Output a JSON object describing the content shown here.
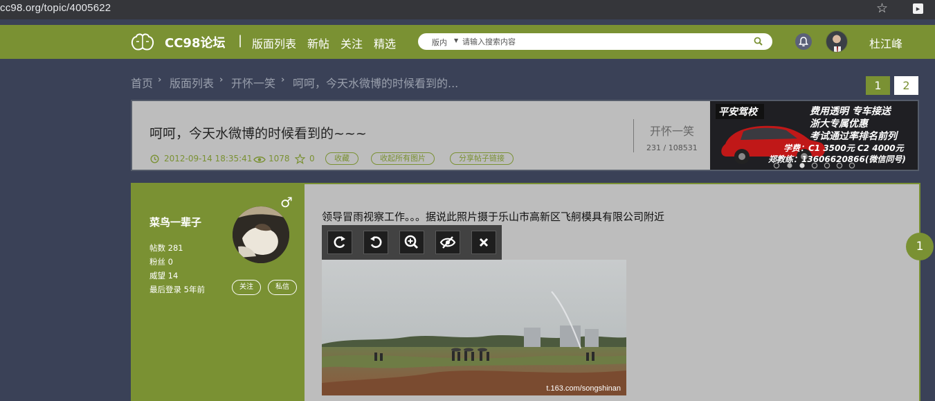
{
  "browser": {
    "url": "cc98.org/topic/4005622"
  },
  "nav": {
    "brand": "CC98论坛",
    "separator": "|",
    "links": [
      "版面列表",
      "新帖",
      "关注",
      "精选"
    ],
    "search": {
      "scope": "版内",
      "placeholder": "请输入搜索内容"
    },
    "username": "杜江峰"
  },
  "breadcrumb": [
    "首页",
    "版面列表",
    "开怀一笑",
    "呵呵，今天水微博的时候看到的..."
  ],
  "pagination": [
    "1",
    "2"
  ],
  "topic": {
    "title": "呵呵，今天水微博的时候看到的~~~",
    "datetime": "2012-09-14 18:35:41",
    "views": "1078",
    "favorites": "0",
    "tags": [
      "收藏",
      "收起所有图片",
      "分享帖子链接"
    ],
    "board": "开怀一笑",
    "board_count": "231 / 108531"
  },
  "ad": {
    "brand": "平安驾校",
    "line1": "费用透明 专车接送",
    "line2": "浙大专属优惠",
    "line3": "考试通过率排名前列",
    "fee": "学费：C1 3500元 C2 4000元",
    "contact": "郑教练：13606620866(微信同号)"
  },
  "post": {
    "username": "菜鸟一辈子",
    "gender": "♂",
    "stats": [
      "帖数 281",
      "粉丝 0",
      "威望 14",
      "最后登录 5年前"
    ],
    "follow_label": "关注",
    "message_label": "私信",
    "content": "领导冒雨视察工作。。。据说此照片摄于乐山市高新区飞舸模具有限公司附近",
    "watermark": "t.163.com/songshinan",
    "floor": "1"
  },
  "colors": {
    "accent": "#7a9133",
    "background": "#3a4157",
    "card": "#bdbdbd"
  }
}
